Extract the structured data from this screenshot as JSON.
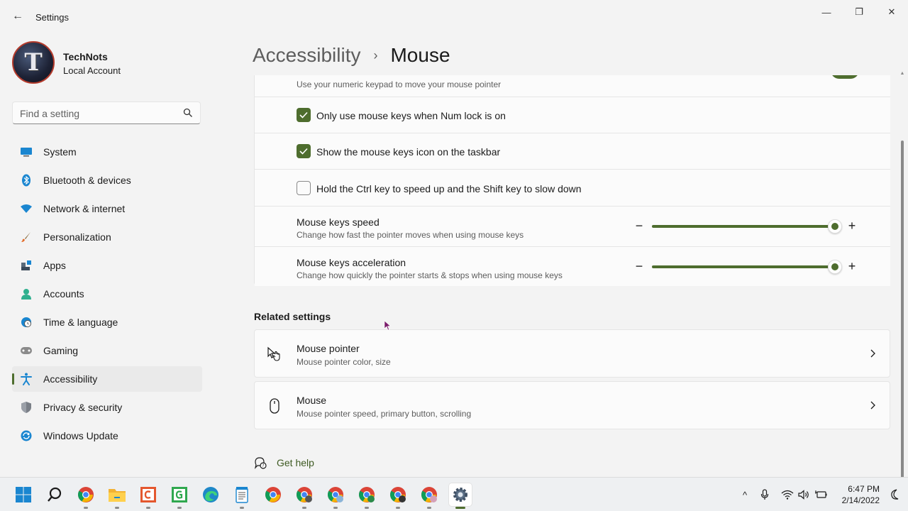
{
  "window": {
    "title": "Settings",
    "back_glyph": "←",
    "minimize_glyph": "—",
    "maximize_glyph": "❐",
    "close_glyph": "✕"
  },
  "profile": {
    "avatar_letter": "T",
    "name": "TechNots",
    "account_type": "Local Account"
  },
  "search": {
    "placeholder": "Find a setting"
  },
  "sidebar": {
    "items": [
      {
        "label": "System",
        "icon": "system-icon"
      },
      {
        "label": "Bluetooth & devices",
        "icon": "bluetooth-icon"
      },
      {
        "label": "Network & internet",
        "icon": "network-icon"
      },
      {
        "label": "Personalization",
        "icon": "brush-icon"
      },
      {
        "label": "Apps",
        "icon": "apps-icon"
      },
      {
        "label": "Accounts",
        "icon": "accounts-icon"
      },
      {
        "label": "Time & language",
        "icon": "globe-clock-icon"
      },
      {
        "label": "Gaming",
        "icon": "gamepad-icon"
      },
      {
        "label": "Accessibility",
        "icon": "accessibility-icon",
        "active": true
      },
      {
        "label": "Privacy & security",
        "icon": "shield-icon"
      },
      {
        "label": "Windows Update",
        "icon": "update-icon"
      }
    ]
  },
  "breadcrumb": {
    "parent": "Accessibility",
    "separator": "›",
    "current": "Mouse"
  },
  "mouse_keys": {
    "header_subtitle": "Use your numeric keypad to move your mouse pointer",
    "options": [
      {
        "label": "Only use mouse keys when Num lock is on",
        "checked": true
      },
      {
        "label": "Show the mouse keys icon on the taskbar",
        "checked": true
      },
      {
        "label": "Hold the Ctrl key to speed up and the Shift key to slow down",
        "checked": false
      }
    ],
    "speed": {
      "title": "Mouse keys speed",
      "subtitle": "Change how fast the pointer moves when using mouse keys",
      "value_fraction": 1.0,
      "minus": "−",
      "plus": "+"
    },
    "acceleration": {
      "title": "Mouse keys acceleration",
      "subtitle": "Change how quickly the pointer starts & stops when using mouse keys",
      "value_fraction": 1.0,
      "minus": "−",
      "plus": "+"
    }
  },
  "related": {
    "heading": "Related settings",
    "items": [
      {
        "title": "Mouse pointer",
        "subtitle": "Mouse pointer color, size",
        "icon": "mouse-pointer-icon"
      },
      {
        "title": "Mouse",
        "subtitle": "Mouse pointer speed, primary button, scrolling",
        "icon": "mouse-icon"
      }
    ]
  },
  "get_help": {
    "label": "Get help"
  },
  "taskbar": {
    "apps": [
      "start-icon",
      "search-icon",
      "chrome-icon",
      "file-explorer-icon",
      "jetbrains-c-icon",
      "jetbrains-g-icon",
      "edge-icon",
      "notepad-icon",
      "chrome-icon",
      "chrome-icon",
      "chrome-icon",
      "chrome-icon",
      "chrome-icon",
      "chrome-icon",
      "settings-gear-icon"
    ],
    "tray": {
      "chevron": "^",
      "clock_time": "6:47 PM",
      "clock_date": "2/14/2022"
    }
  },
  "colors": {
    "accent": "#4e6d2e",
    "background": "#f3f3f3",
    "card": "#fbfbfb"
  }
}
